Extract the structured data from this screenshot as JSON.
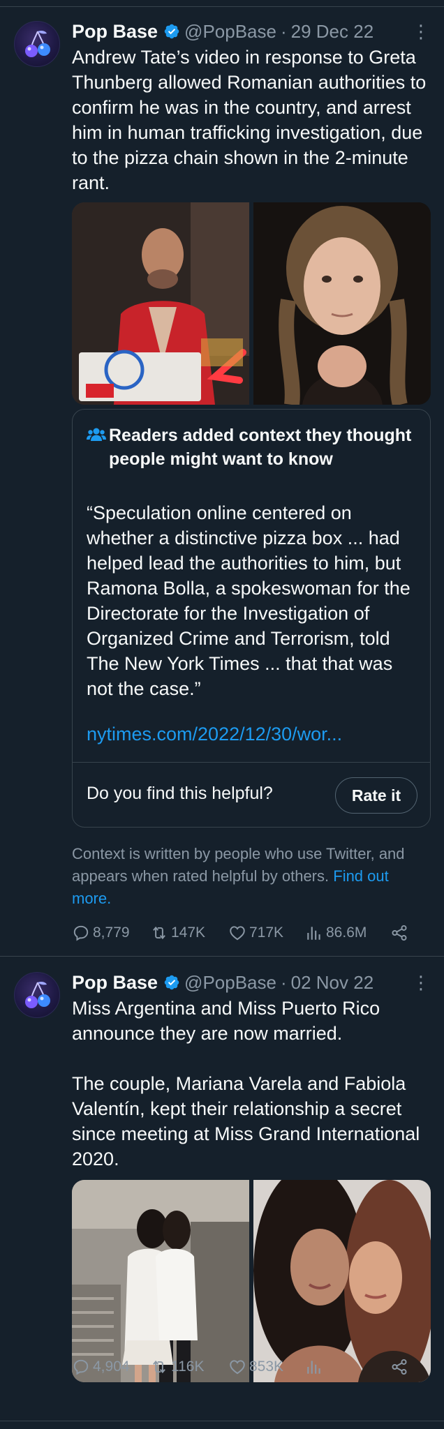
{
  "tweets": [
    {
      "author": "Pop Base",
      "handle": "@PopBase",
      "sep": "·",
      "date": "29 Dec 22",
      "text": "Andrew Tate’s video in response to Greta Thunberg allowed Romanian authorities to confirm he was in the country, and arrest him in human trafficking investigation, due to the pizza chain shown in the 2-minute rant.",
      "note": {
        "title": "Readers added context they thought people might want to know",
        "quote": "“Speculation online centered on whether a distinctive pizza box ... had helped lead the authorities to him, but Ramona Bolla, a spokeswoman for the Directorate for the Investigation of Organized Crime and Terrorism, told The New York Times ... that that was not the case.”",
        "link": "nytimes.com/2022/12/30/wor...",
        "question": "Do you find this helpful?",
        "rate_label": "Rate it"
      },
      "context_text": "Context is written by people who use Twitter, and appears when rated helpful by others. ",
      "context_link": "Find out more.",
      "replies": "8,779",
      "retweets": "147K",
      "likes": "717K",
      "views": "86.6M"
    },
    {
      "author": "Pop Base",
      "handle": "@PopBase",
      "sep": "·",
      "date": "02 Nov 22",
      "text": "Miss Argentina and Miss Puerto Rico announce they are now married.\n\nThe couple, Mariana Varela and Fabiola Valentín, kept their relationship a secret since meeting at Miss Grand International 2020.",
      "replies": "4,904",
      "retweets": "116K",
      "likes": "853K",
      "views": ""
    }
  ],
  "colors": {
    "background": "#15202b",
    "secondary_text": "#8b98a5",
    "link": "#1d9bf0",
    "border": "#38444d"
  },
  "icons": [
    "verified-badge-icon",
    "more-icon",
    "people-icon",
    "reply-icon",
    "retweet-icon",
    "like-icon",
    "views-icon",
    "share-icon"
  ]
}
